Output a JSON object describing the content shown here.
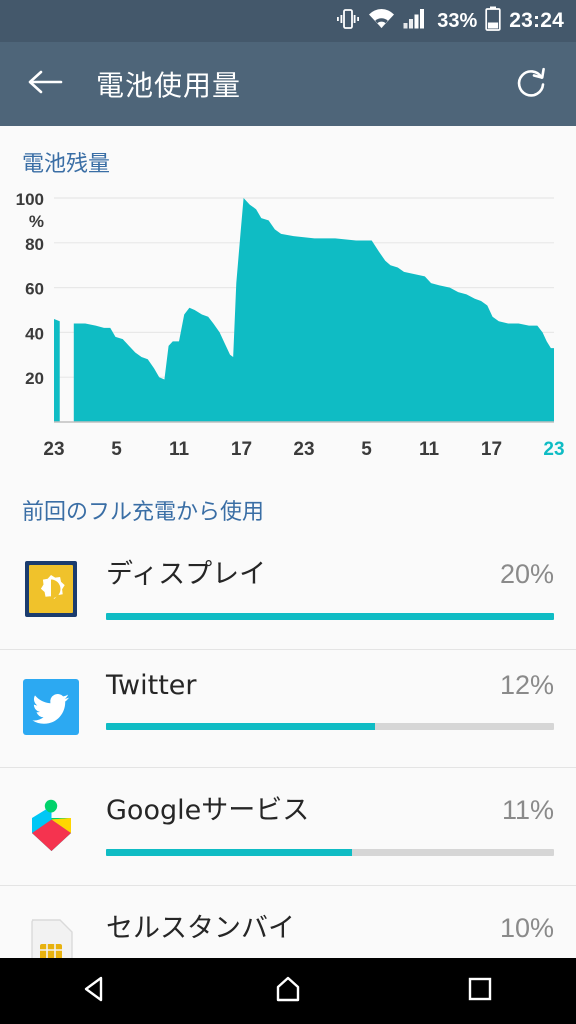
{
  "statusbar": {
    "vibrate_icon": "vibrate-icon",
    "wifi_icon": "wifi-icon",
    "signal_icon": "signal-icon",
    "battery_percent": "33%",
    "battery_icon": "battery-icon",
    "clock": "23:24"
  },
  "appbar": {
    "back_icon": "back-arrow-icon",
    "title": "電池使用量",
    "refresh_icon": "refresh-icon"
  },
  "chart_section": {
    "header": "電池残量"
  },
  "usage_section": {
    "header": "前回のフル充電から使用"
  },
  "apps": [
    {
      "name": "ディスプレイ",
      "percent": "20%",
      "value": 20,
      "fill_ratio": 1.0,
      "icon": "display-brightness-icon"
    },
    {
      "name": "Twitter",
      "percent": "12%",
      "value": 12,
      "fill_ratio": 0.6,
      "icon": "twitter-icon"
    },
    {
      "name": "Googleサービス",
      "percent": "11%",
      "value": 11,
      "fill_ratio": 0.55,
      "icon": "google-play-services-icon"
    },
    {
      "name": "セルスタンバイ",
      "percent": "10%",
      "value": 10,
      "fill_ratio": 0.5,
      "icon": "sim-card-icon"
    }
  ],
  "navbar": {
    "back_icon": "nav-back-triangle-icon",
    "home_icon": "nav-home-icon",
    "recents_icon": "nav-recents-square-icon"
  },
  "colors": {
    "accent_teal": "#0FBCC4",
    "appbar_bg": "#4E6579",
    "statusbar_bg": "#44586B",
    "section_header": "#3A6EA5",
    "page_bg": "#FAFAFA",
    "track_gray": "#D6D6D6"
  },
  "chart_data": {
    "type": "area",
    "title": "電池残量",
    "xlabel": "",
    "ylabel": "%",
    "ylim": [
      0,
      100
    ],
    "xlim": [
      0,
      48
    ],
    "grid": true,
    "y_ticks": [
      100,
      80,
      60,
      40,
      20
    ],
    "y_tick_labels": [
      "100",
      "80",
      "60",
      "40",
      "20"
    ],
    "y_unit_label": "%",
    "x_tick_labels": [
      "23",
      "5",
      "11",
      "17",
      "23",
      "5",
      "11",
      "17",
      "23"
    ],
    "x_tick_values": [
      0,
      6,
      12,
      18,
      24,
      30,
      36,
      42,
      48
    ],
    "highlight_last_tick": true,
    "series_name": "battery_level",
    "segments": [
      {
        "note": "pre-gap stub",
        "points": [
          {
            "x": 0.0,
            "y": 46
          },
          {
            "x": 0.55,
            "y": 45
          }
        ]
      },
      {
        "note": "main trace",
        "points": [
          {
            "x": 1.9,
            "y": 44
          },
          {
            "x": 3.0,
            "y": 44
          },
          {
            "x": 4.0,
            "y": 43
          },
          {
            "x": 4.8,
            "y": 42
          },
          {
            "x": 5.4,
            "y": 42
          },
          {
            "x": 5.9,
            "y": 38
          },
          {
            "x": 6.6,
            "y": 37
          },
          {
            "x": 7.2,
            "y": 34
          },
          {
            "x": 7.8,
            "y": 31
          },
          {
            "x": 8.4,
            "y": 29
          },
          {
            "x": 9.0,
            "y": 28
          },
          {
            "x": 9.6,
            "y": 24
          },
          {
            "x": 10.1,
            "y": 20
          },
          {
            "x": 10.6,
            "y": 19
          },
          {
            "x": 11.0,
            "y": 34
          },
          {
            "x": 11.4,
            "y": 36
          },
          {
            "x": 12.0,
            "y": 36
          },
          {
            "x": 12.5,
            "y": 48
          },
          {
            "x": 13.0,
            "y": 51
          },
          {
            "x": 13.5,
            "y": 50
          },
          {
            "x": 14.2,
            "y": 48
          },
          {
            "x": 14.8,
            "y": 47
          },
          {
            "x": 15.3,
            "y": 44
          },
          {
            "x": 15.9,
            "y": 40
          },
          {
            "x": 16.4,
            "y": 35
          },
          {
            "x": 16.9,
            "y": 30
          },
          {
            "x": 17.2,
            "y": 29
          },
          {
            "x": 17.5,
            "y": 62
          },
          {
            "x": 17.9,
            "y": 84
          },
          {
            "x": 18.2,
            "y": 100
          },
          {
            "x": 18.8,
            "y": 97
          },
          {
            "x": 19.4,
            "y": 95
          },
          {
            "x": 19.9,
            "y": 91
          },
          {
            "x": 20.6,
            "y": 90
          },
          {
            "x": 21.2,
            "y": 86
          },
          {
            "x": 21.8,
            "y": 84
          },
          {
            "x": 23.0,
            "y": 83
          },
          {
            "x": 25.0,
            "y": 82
          },
          {
            "x": 27.0,
            "y": 82
          },
          {
            "x": 29.0,
            "y": 81
          },
          {
            "x": 30.5,
            "y": 81
          },
          {
            "x": 31.2,
            "y": 76
          },
          {
            "x": 31.8,
            "y": 72
          },
          {
            "x": 32.3,
            "y": 70
          },
          {
            "x": 33.0,
            "y": 69
          },
          {
            "x": 33.6,
            "y": 67
          },
          {
            "x": 34.6,
            "y": 66
          },
          {
            "x": 35.6,
            "y": 65
          },
          {
            "x": 36.2,
            "y": 62
          },
          {
            "x": 37.0,
            "y": 61
          },
          {
            "x": 38.0,
            "y": 60
          },
          {
            "x": 38.8,
            "y": 58
          },
          {
            "x": 39.6,
            "y": 57
          },
          {
            "x": 40.4,
            "y": 55
          },
          {
            "x": 41.0,
            "y": 54
          },
          {
            "x": 41.6,
            "y": 52
          },
          {
            "x": 42.1,
            "y": 47
          },
          {
            "x": 42.7,
            "y": 45
          },
          {
            "x": 43.6,
            "y": 44
          },
          {
            "x": 44.6,
            "y": 44
          },
          {
            "x": 45.6,
            "y": 43
          },
          {
            "x": 46.4,
            "y": 43
          },
          {
            "x": 46.9,
            "y": 40
          },
          {
            "x": 47.3,
            "y": 36
          },
          {
            "x": 47.7,
            "y": 33
          },
          {
            "x": 48.0,
            "y": 33
          }
        ]
      }
    ]
  }
}
